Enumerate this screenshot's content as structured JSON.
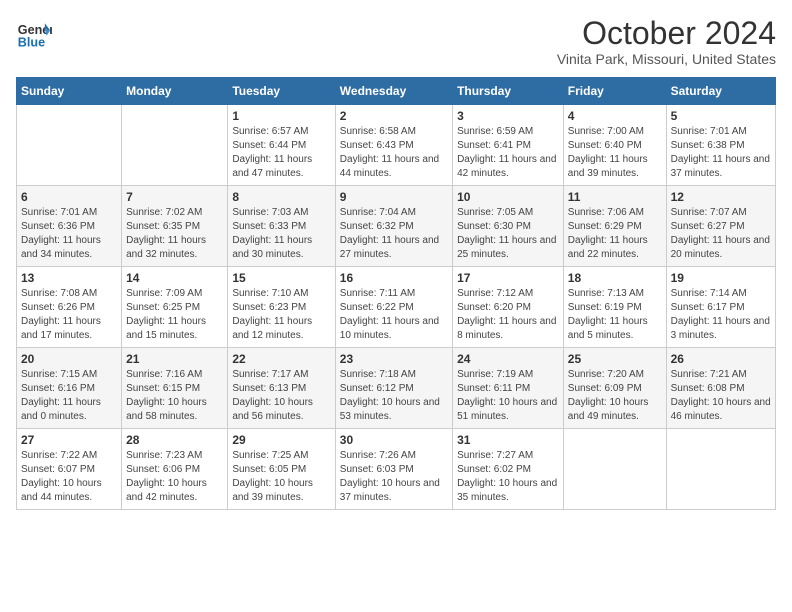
{
  "logo": {
    "line1": "General",
    "line2": "Blue"
  },
  "title": "October 2024",
  "subtitle": "Vinita Park, Missouri, United States",
  "days_header": [
    "Sunday",
    "Monday",
    "Tuesday",
    "Wednesday",
    "Thursday",
    "Friday",
    "Saturday"
  ],
  "weeks": [
    [
      {
        "day": "",
        "sunrise": "",
        "sunset": "",
        "daylight": ""
      },
      {
        "day": "",
        "sunrise": "",
        "sunset": "",
        "daylight": ""
      },
      {
        "day": "1",
        "sunrise": "Sunrise: 6:57 AM",
        "sunset": "Sunset: 6:44 PM",
        "daylight": "Daylight: 11 hours and 47 minutes."
      },
      {
        "day": "2",
        "sunrise": "Sunrise: 6:58 AM",
        "sunset": "Sunset: 6:43 PM",
        "daylight": "Daylight: 11 hours and 44 minutes."
      },
      {
        "day": "3",
        "sunrise": "Sunrise: 6:59 AM",
        "sunset": "Sunset: 6:41 PM",
        "daylight": "Daylight: 11 hours and 42 minutes."
      },
      {
        "day": "4",
        "sunrise": "Sunrise: 7:00 AM",
        "sunset": "Sunset: 6:40 PM",
        "daylight": "Daylight: 11 hours and 39 minutes."
      },
      {
        "day": "5",
        "sunrise": "Sunrise: 7:01 AM",
        "sunset": "Sunset: 6:38 PM",
        "daylight": "Daylight: 11 hours and 37 minutes."
      }
    ],
    [
      {
        "day": "6",
        "sunrise": "Sunrise: 7:01 AM",
        "sunset": "Sunset: 6:36 PM",
        "daylight": "Daylight: 11 hours and 34 minutes."
      },
      {
        "day": "7",
        "sunrise": "Sunrise: 7:02 AM",
        "sunset": "Sunset: 6:35 PM",
        "daylight": "Daylight: 11 hours and 32 minutes."
      },
      {
        "day": "8",
        "sunrise": "Sunrise: 7:03 AM",
        "sunset": "Sunset: 6:33 PM",
        "daylight": "Daylight: 11 hours and 30 minutes."
      },
      {
        "day": "9",
        "sunrise": "Sunrise: 7:04 AM",
        "sunset": "Sunset: 6:32 PM",
        "daylight": "Daylight: 11 hours and 27 minutes."
      },
      {
        "day": "10",
        "sunrise": "Sunrise: 7:05 AM",
        "sunset": "Sunset: 6:30 PM",
        "daylight": "Daylight: 11 hours and 25 minutes."
      },
      {
        "day": "11",
        "sunrise": "Sunrise: 7:06 AM",
        "sunset": "Sunset: 6:29 PM",
        "daylight": "Daylight: 11 hours and 22 minutes."
      },
      {
        "day": "12",
        "sunrise": "Sunrise: 7:07 AM",
        "sunset": "Sunset: 6:27 PM",
        "daylight": "Daylight: 11 hours and 20 minutes."
      }
    ],
    [
      {
        "day": "13",
        "sunrise": "Sunrise: 7:08 AM",
        "sunset": "Sunset: 6:26 PM",
        "daylight": "Daylight: 11 hours and 17 minutes."
      },
      {
        "day": "14",
        "sunrise": "Sunrise: 7:09 AM",
        "sunset": "Sunset: 6:25 PM",
        "daylight": "Daylight: 11 hours and 15 minutes."
      },
      {
        "day": "15",
        "sunrise": "Sunrise: 7:10 AM",
        "sunset": "Sunset: 6:23 PM",
        "daylight": "Daylight: 11 hours and 12 minutes."
      },
      {
        "day": "16",
        "sunrise": "Sunrise: 7:11 AM",
        "sunset": "Sunset: 6:22 PM",
        "daylight": "Daylight: 11 hours and 10 minutes."
      },
      {
        "day": "17",
        "sunrise": "Sunrise: 7:12 AM",
        "sunset": "Sunset: 6:20 PM",
        "daylight": "Daylight: 11 hours and 8 minutes."
      },
      {
        "day": "18",
        "sunrise": "Sunrise: 7:13 AM",
        "sunset": "Sunset: 6:19 PM",
        "daylight": "Daylight: 11 hours and 5 minutes."
      },
      {
        "day": "19",
        "sunrise": "Sunrise: 7:14 AM",
        "sunset": "Sunset: 6:17 PM",
        "daylight": "Daylight: 11 hours and 3 minutes."
      }
    ],
    [
      {
        "day": "20",
        "sunrise": "Sunrise: 7:15 AM",
        "sunset": "Sunset: 6:16 PM",
        "daylight": "Daylight: 11 hours and 0 minutes."
      },
      {
        "day": "21",
        "sunrise": "Sunrise: 7:16 AM",
        "sunset": "Sunset: 6:15 PM",
        "daylight": "Daylight: 10 hours and 58 minutes."
      },
      {
        "day": "22",
        "sunrise": "Sunrise: 7:17 AM",
        "sunset": "Sunset: 6:13 PM",
        "daylight": "Daylight: 10 hours and 56 minutes."
      },
      {
        "day": "23",
        "sunrise": "Sunrise: 7:18 AM",
        "sunset": "Sunset: 6:12 PM",
        "daylight": "Daylight: 10 hours and 53 minutes."
      },
      {
        "day": "24",
        "sunrise": "Sunrise: 7:19 AM",
        "sunset": "Sunset: 6:11 PM",
        "daylight": "Daylight: 10 hours and 51 minutes."
      },
      {
        "day": "25",
        "sunrise": "Sunrise: 7:20 AM",
        "sunset": "Sunset: 6:09 PM",
        "daylight": "Daylight: 10 hours and 49 minutes."
      },
      {
        "day": "26",
        "sunrise": "Sunrise: 7:21 AM",
        "sunset": "Sunset: 6:08 PM",
        "daylight": "Daylight: 10 hours and 46 minutes."
      }
    ],
    [
      {
        "day": "27",
        "sunrise": "Sunrise: 7:22 AM",
        "sunset": "Sunset: 6:07 PM",
        "daylight": "Daylight: 10 hours and 44 minutes."
      },
      {
        "day": "28",
        "sunrise": "Sunrise: 7:23 AM",
        "sunset": "Sunset: 6:06 PM",
        "daylight": "Daylight: 10 hours and 42 minutes."
      },
      {
        "day": "29",
        "sunrise": "Sunrise: 7:25 AM",
        "sunset": "Sunset: 6:05 PM",
        "daylight": "Daylight: 10 hours and 39 minutes."
      },
      {
        "day": "30",
        "sunrise": "Sunrise: 7:26 AM",
        "sunset": "Sunset: 6:03 PM",
        "daylight": "Daylight: 10 hours and 37 minutes."
      },
      {
        "day": "31",
        "sunrise": "Sunrise: 7:27 AM",
        "sunset": "Sunset: 6:02 PM",
        "daylight": "Daylight: 10 hours and 35 minutes."
      },
      {
        "day": "",
        "sunrise": "",
        "sunset": "",
        "daylight": ""
      },
      {
        "day": "",
        "sunrise": "",
        "sunset": "",
        "daylight": ""
      }
    ]
  ]
}
